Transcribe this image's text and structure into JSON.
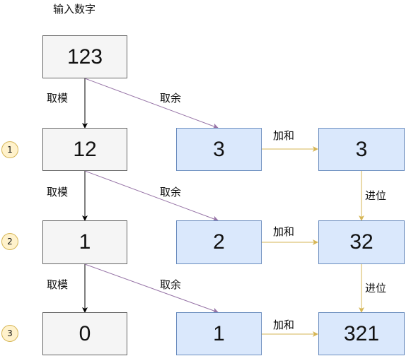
{
  "title": "输入数字",
  "steps": [
    {
      "badge": "1",
      "quotient": "12",
      "remainder": "3",
      "result": "3"
    },
    {
      "badge": "2",
      "quotient": "1",
      "remainder": "2",
      "result": "32"
    },
    {
      "badge": "3",
      "quotient": "0",
      "remainder": "1",
      "result": "321"
    }
  ],
  "input_value": "123",
  "labels": {
    "mod": "取模",
    "remainder": "取余",
    "add": "加和",
    "carry": "进位"
  },
  "colors": {
    "gray_fill": "#f5f5f5",
    "gray_stroke": "#666666",
    "blue_fill": "#dae8fc",
    "blue_stroke": "#6c8ebf",
    "badge_fill": "#fff2cc",
    "badge_stroke": "#d6b656",
    "purple_edge": "#9673a6",
    "gold_edge": "#d6b656",
    "black_edge": "#000000"
  }
}
